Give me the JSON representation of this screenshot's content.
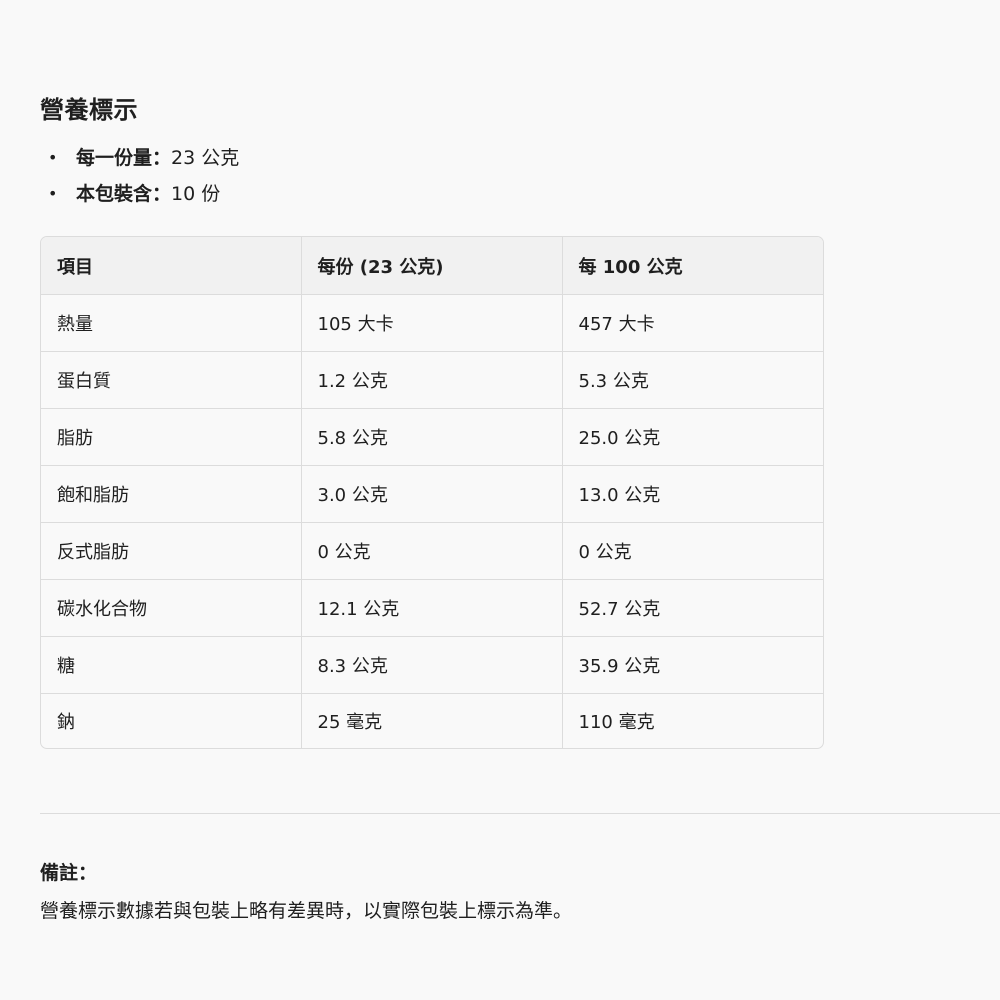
{
  "title": "營養標示",
  "bullets": [
    {
      "label": "每一份量",
      "sep": "：",
      "value": "23 公克"
    },
    {
      "label": "本包裝含",
      "sep": "：",
      "value": "10 份"
    }
  ],
  "table": {
    "headers": [
      "項目",
      "每份 (23 公克)",
      "每 100 公克"
    ],
    "rows": [
      [
        "熱量",
        "105 大卡",
        "457 大卡"
      ],
      [
        "蛋白質",
        "1.2 公克",
        "5.3 公克"
      ],
      [
        "脂肪",
        "5.8 公克",
        "25.0 公克"
      ],
      [
        "飽和脂肪",
        "3.0 公克",
        "13.0 公克"
      ],
      [
        "反式脂肪",
        "0 公克",
        "0 公克"
      ],
      [
        "碳水化合物",
        "12.1 公克",
        "52.7 公克"
      ],
      [
        "糖",
        "8.3 公克",
        "35.9 公克"
      ],
      [
        "鈉",
        "25 毫克",
        "110 毫克"
      ]
    ]
  },
  "note": {
    "label": "備註：",
    "text": "營養標示數據若與包裝上略有差異時，以實際包裝上標示為準。"
  }
}
